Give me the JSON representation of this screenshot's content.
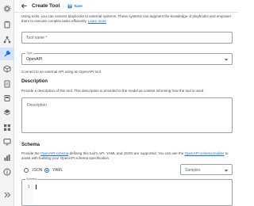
{
  "header": {
    "title": "Create Tool",
    "save_label": "Save"
  },
  "intro": {
    "text": "Using tools, you can connect playbooks to external systems. These systems can augment the knowledge of playbooks and empower them to execute complex tasks efficiently.",
    "link": "Learn more"
  },
  "tool_name": {
    "placeholder": "Tool name *"
  },
  "type": {
    "label": "Type",
    "value": "OpenAPI"
  },
  "connect_text": "Connect to an external API using an OpenAPI tool.",
  "description": {
    "heading": "Description",
    "help": "Provide a description of this tool. This description is provided to the model as context informing how the tool is used.",
    "placeholder": "Description"
  },
  "schema": {
    "heading": "Schema",
    "help_prefix": "Provide the",
    "help_link1": "OpenAPI schema",
    "help_middle": "defining this tool's API. YAML and JSON are supported. You can use the",
    "help_link2": "OpenAPI schema builder",
    "help_suffix": "to assist with building your OpenAPI schema specification.",
    "format_options": [
      "JSON",
      "YAML"
    ],
    "selected_format": "YAML",
    "samples_placeholder": "Samples",
    "editor_label": "Schema",
    "line_number": "1"
  },
  "colors": {
    "accent": "#1a73e8",
    "rail": "#f1f3f4",
    "active_rail": "#d3e3fd"
  }
}
